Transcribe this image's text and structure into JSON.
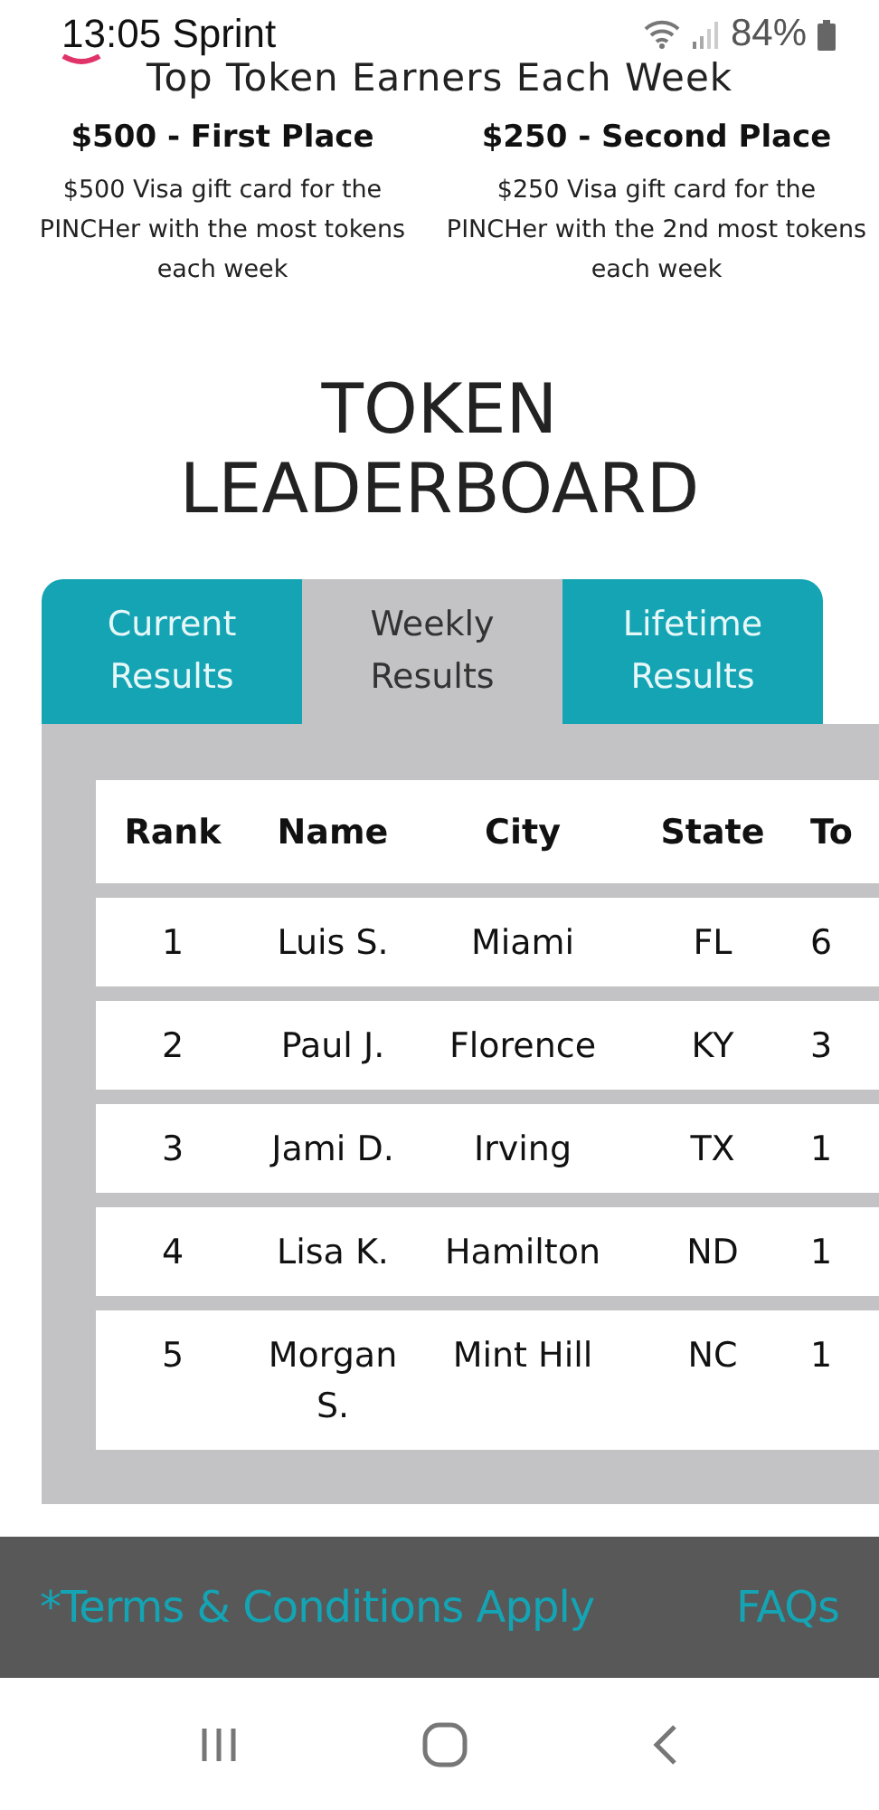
{
  "status_bar": {
    "time": "13:05",
    "carrier": "Sprint",
    "battery": "84%"
  },
  "heading": "Top Token Earners Each Week",
  "prizes": [
    {
      "title": "$500 - First Place",
      "description": "$500 Visa gift card for the PINCHer with the most tokens each week"
    },
    {
      "title": "$250 - Second Place",
      "description": "$250 Visa gift card for the PINCHer with the 2nd most tokens each week"
    }
  ],
  "leaderboard_title": "TOKEN LEADERBOARD",
  "tabs": [
    {
      "label": "Current Results",
      "selected": false
    },
    {
      "label": "Weekly Results",
      "selected": true
    },
    {
      "label": "Lifetime Results",
      "selected": false
    }
  ],
  "table": {
    "columns": [
      "Rank",
      "Name",
      "City",
      "State",
      "To"
    ],
    "rows": [
      [
        "1",
        "Luis S.",
        "Miami",
        "FL",
        "6"
      ],
      [
        "2",
        "Paul J.",
        "Florence",
        "KY",
        "3"
      ],
      [
        "3",
        "Jami D.",
        "Irving",
        "TX",
        "1"
      ],
      [
        "4",
        "Lisa K.",
        "Hamilton",
        "ND",
        "1"
      ],
      [
        "5",
        "Morgan S.",
        "Mint Hill",
        "NC",
        "1"
      ]
    ]
  },
  "footer": {
    "terms": "*Terms & Conditions Apply",
    "faqs": "FAQs"
  }
}
